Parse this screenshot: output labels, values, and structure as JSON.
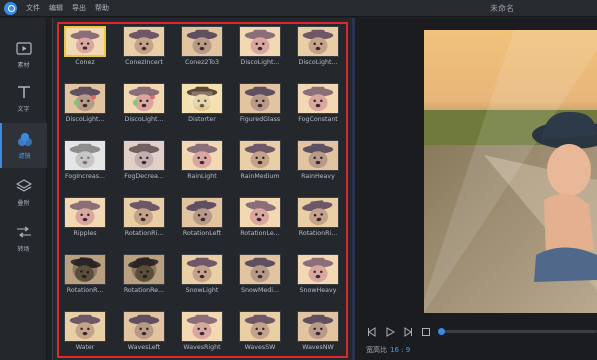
{
  "app": {
    "title": "未命名",
    "menu": [
      "文件",
      "编辑",
      "导出",
      "帮助"
    ],
    "accent": "#3d8be0",
    "highlight_color": "#e0272d"
  },
  "sidebar": {
    "items": [
      {
        "label": "素材",
        "icon": "media-icon"
      },
      {
        "label": "文字",
        "icon": "text-icon"
      },
      {
        "label": "滤镜",
        "icon": "filter-icon",
        "active": true
      },
      {
        "label": "叠附",
        "icon": "overlay-icon"
      },
      {
        "label": "转场",
        "icon": "transition-icon"
      }
    ]
  },
  "filters": [
    {
      "label": "Conez",
      "selected": true
    },
    {
      "label": "ConezIncert"
    },
    {
      "label": "Conez2To3"
    },
    {
      "label": "DiscoLight..."
    },
    {
      "label": "DiscoLight..."
    },
    {
      "label": "DiscoLight..."
    },
    {
      "label": "DiscoLight..."
    },
    {
      "label": "Distorter"
    },
    {
      "label": "FiguredGlass"
    },
    {
      "label": "FogConstant"
    },
    {
      "label": "FogIncreas..."
    },
    {
      "label": "FogDecrea..."
    },
    {
      "label": "RainLight"
    },
    {
      "label": "RainMedium"
    },
    {
      "label": "RainHeavy"
    },
    {
      "label": "Ripples"
    },
    {
      "label": "RotationRi..."
    },
    {
      "label": "RotationLeft"
    },
    {
      "label": "RotationLe..."
    },
    {
      "label": "RotationRi..."
    },
    {
      "label": "RotationR..."
    },
    {
      "label": "RotationRe..."
    },
    {
      "label": "SnowLight"
    },
    {
      "label": "SnowMedi..."
    },
    {
      "label": "SnowHeavy"
    },
    {
      "label": "Water"
    },
    {
      "label": "WavesLeft"
    },
    {
      "label": "WavesRight"
    },
    {
      "label": "WavesSW"
    },
    {
      "label": "WavesNW"
    }
  ],
  "preview": {
    "aspect_label": "宽高比",
    "aspect_value": "16 : 9",
    "progress": 0.0
  }
}
